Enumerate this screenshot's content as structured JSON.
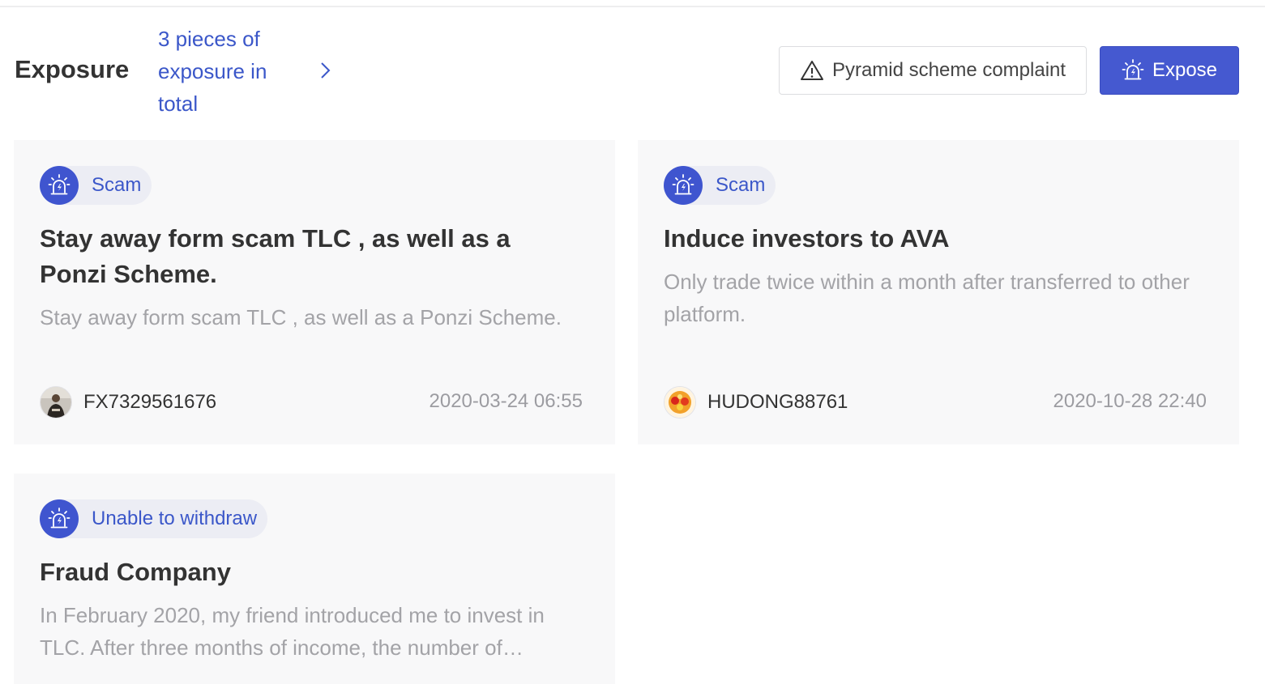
{
  "header": {
    "title": "Exposure",
    "total_link": "3 pieces of exposure in total",
    "complaint_button": "Pyramid scheme complaint",
    "expose_button": "Expose"
  },
  "cards": [
    {
      "tag": "Scam",
      "title": "Stay away form scam TLC , as well as a Ponzi Scheme.",
      "description": "Stay away form scam TLC , as well as a Ponzi Scheme.",
      "author": "FX7329561676",
      "date": "2020-03-24 06:55"
    },
    {
      "tag": "Scam",
      "title": "Induce investors to AVA",
      "description": "Only trade twice within a month after transferred to other platform.",
      "author": "HUDONG88761",
      "date": "2020-10-28 22:40"
    },
    {
      "tag": "Unable to withdraw",
      "title": "Fraud Company",
      "description": "In February 2020, my friend introduced me to invest in TLC. After three months of income, the number of…"
    }
  ],
  "colors": {
    "accent": "#4559d0",
    "link": "#3b57c9",
    "card_bg": "#f8f8f9",
    "tag_bg": "#ecedf4",
    "muted_text": "#a3a3a7"
  },
  "icons": {
    "complaint": "warning-triangle-icon",
    "expose": "alarm-siren-icon",
    "tag": "alarm-siren-icon",
    "total_link": "chevron-right-icon"
  }
}
